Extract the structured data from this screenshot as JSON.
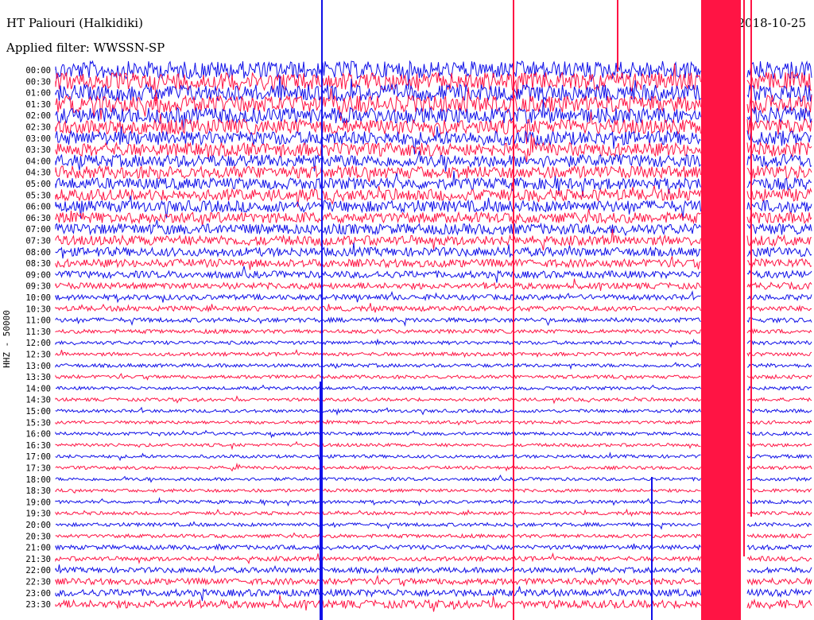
{
  "header": {
    "station": "HT Paliouri (Halkidiki)",
    "date": "2018-10-25",
    "filter": "Applied filter: WWSSN-SP",
    "channel": "HHZ - 50000"
  },
  "colors": {
    "blue": "#1010e8",
    "red": "#ff1444",
    "background": "#ffffff"
  },
  "chart_data": {
    "type": "line",
    "title": "HT Paliouri (Halkidiki)",
    "ylabel": "HHZ - 50000",
    "row_labels": [
      "00:00",
      "00:30",
      "01:00",
      "01:30",
      "02:00",
      "02:30",
      "03:00",
      "03:30",
      "04:00",
      "04:30",
      "05:00",
      "05:30",
      "06:00",
      "06:30",
      "07:00",
      "07:30",
      "08:00",
      "08:30",
      "09:00",
      "09:30",
      "10:00",
      "10:30",
      "11:00",
      "11:30",
      "12:00",
      "12:30",
      "13:00",
      "13:30",
      "14:00",
      "14:30",
      "15:00",
      "15:30",
      "16:00",
      "16:30",
      "17:00",
      "17:30",
      "18:00",
      "18:30",
      "19:00",
      "19:30",
      "20:00",
      "20:30",
      "21:00",
      "21:30",
      "22:00",
      "22:30",
      "23:00",
      "23:30"
    ],
    "row_colors": [
      "blue",
      "red"
    ],
    "relative_noise_amplitude": [
      1.0,
      1.0,
      0.95,
      0.95,
      0.9,
      0.85,
      0.8,
      0.75,
      0.7,
      0.7,
      0.65,
      0.65,
      0.65,
      0.6,
      0.6,
      0.55,
      0.5,
      0.45,
      0.4,
      0.35,
      0.3,
      0.28,
      0.25,
      0.22,
      0.2,
      0.2,
      0.2,
      0.2,
      0.18,
      0.18,
      0.18,
      0.18,
      0.18,
      0.18,
      0.18,
      0.18,
      0.18,
      0.18,
      0.18,
      0.18,
      0.2,
      0.2,
      0.25,
      0.25,
      0.3,
      0.35,
      0.4,
      0.45
    ]
  }
}
